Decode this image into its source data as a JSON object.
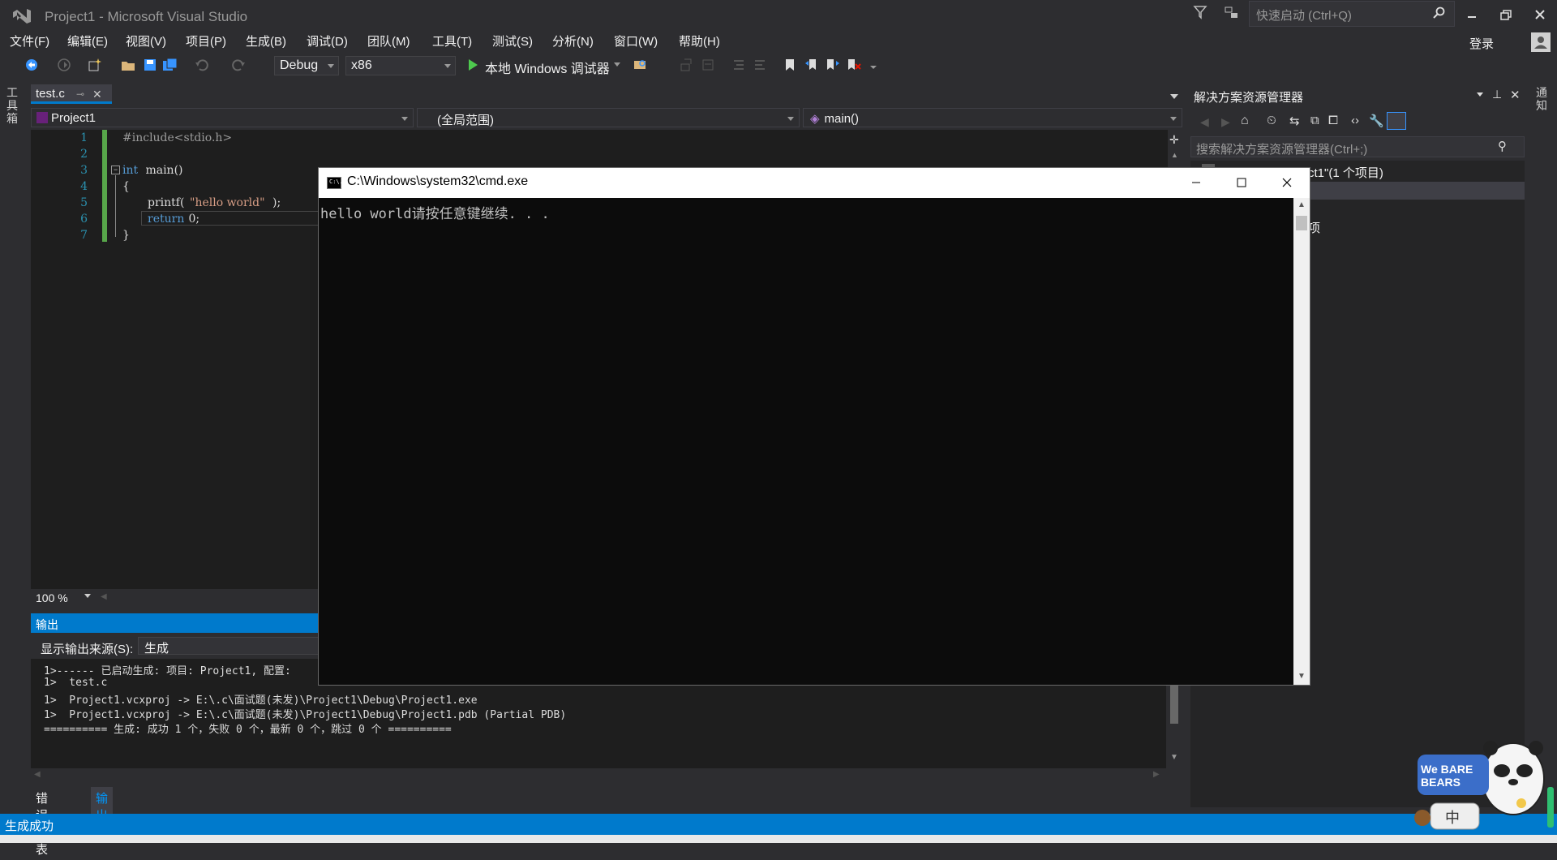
{
  "window": {
    "title": "Project1 - Microsoft Visual Studio"
  },
  "quick_launch": {
    "placeholder": "快速启动 (Ctrl+Q)"
  },
  "menu": [
    {
      "label": "文件(F)"
    },
    {
      "label": "编辑(E)"
    },
    {
      "label": "视图(V)"
    },
    {
      "label": "项目(P)"
    },
    {
      "label": "生成(B)"
    },
    {
      "label": "调试(D)"
    },
    {
      "label": "团队(M)"
    },
    {
      "label": "工具(T)"
    },
    {
      "label": "测试(S)"
    },
    {
      "label": "分析(N)"
    },
    {
      "label": "窗口(W)"
    },
    {
      "label": "帮助(H)"
    }
  ],
  "account": {
    "login_label": "登录"
  },
  "toolbar": {
    "config": "Debug",
    "platform": "x86",
    "run_label": "本地 Windows 调试器"
  },
  "left_strip": {
    "toolbox_label": "工具箱"
  },
  "right_strip": {
    "notify_label": "通知"
  },
  "editor": {
    "tab_name": "test.c",
    "nav_project": "Project1",
    "nav_scope": "(全局范围)",
    "nav_function": "main()",
    "line_numbers": [
      "1",
      "2",
      "3",
      "4",
      "5",
      "6",
      "7"
    ],
    "lines": {
      "l1": "#include<stdio.h>",
      "l3_kw": "int",
      "l3_rest": " main()",
      "l4": "{",
      "l5_pre": "printf(",
      "l5_str": "\"hello world\"",
      "l5_post": ");",
      "l6_kw": "return",
      "l6_rest": " 0;",
      "l7": "}"
    },
    "zoom": "100 %"
  },
  "output": {
    "title": "输出",
    "show_source_label": "显示输出来源(S):",
    "source": "生成",
    "lines": [
      "1>------ 已启动生成: 项目: Project1, 配置:",
      "1>  test.c",
      "1>  Project1.vcxproj -> E:\\.c\\面试题(未发)\\Project1\\Debug\\Project1.exe",
      "1>  Project1.vcxproj -> E:\\.c\\面试题(未发)\\Project1\\Debug\\Project1.pdb (Partial PDB)",
      "========== 生成: 成功 1 个，失败 0 个，最新 0 个，跳过 0 个 =========="
    ],
    "bottom_tabs": [
      "错误列表",
      "输出"
    ]
  },
  "solution_explorer": {
    "title": "解决方案资源管理器",
    "search_placeholder": "搜索解决方案资源管理器(Ctrl+;)",
    "node_visible": "ct1\"(1 个项目)",
    "item_visible": "项"
  },
  "cmd": {
    "title": "C:\\Windows\\system32\\cmd.exe",
    "icon_text": "C:\\.",
    "output": "hello world请按任意键继续. . ."
  },
  "status": {
    "text": "生成成功"
  },
  "mascot": {
    "brand": "We BARE BEARS",
    "badge": "中"
  },
  "colors": {
    "accent": "#007acc",
    "background": "#2d2d30",
    "editor_bg": "#1e1e1e"
  }
}
